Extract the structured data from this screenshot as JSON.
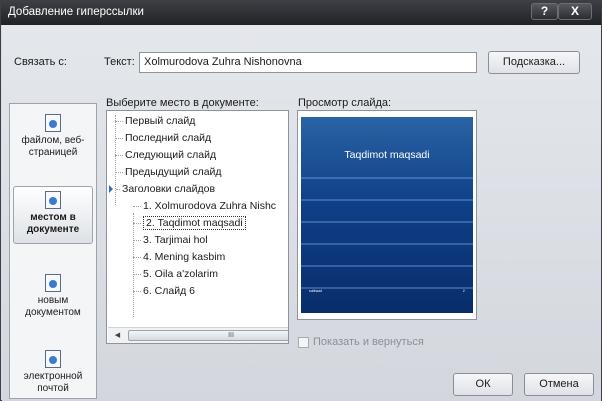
{
  "window": {
    "title": "Добавление гиперссылки",
    "help_label": "?",
    "close_label": "X"
  },
  "link_to": {
    "heading": "Связать с:",
    "items": [
      {
        "label_line1": "файлом, веб-",
        "label_line2": "страницей",
        "icon": "file-web-icon"
      },
      {
        "label_line1": "местом в",
        "label_line2": "документе",
        "icon": "place-in-document-icon",
        "selected": true
      },
      {
        "label_line1": "новым",
        "label_line2": "документом",
        "icon": "new-document-icon"
      },
      {
        "label_line1": "электронной",
        "label_line2": "почтой",
        "icon": "email-icon"
      }
    ]
  },
  "text_field": {
    "label": "Текст:",
    "value": "Xolmurodova Zuhra Nishonovna"
  },
  "tooltip_button": "Подсказка...",
  "place_in_doc": {
    "label": "Выберите место в документе:",
    "items": [
      {
        "text": "Первый слайд",
        "level": 1
      },
      {
        "text": "Последний слайд",
        "level": 1
      },
      {
        "text": "Следующий слайд",
        "level": 1
      },
      {
        "text": "Предыдущий слайд",
        "level": 1
      },
      {
        "text": "Заголовки слайдов",
        "level": 1,
        "expanded": true
      },
      {
        "text": "1. Xolmurodova Zuhra Nishc",
        "level": 2
      },
      {
        "text": "2. Taqdimot maqsadi",
        "level": 2,
        "selected": true
      },
      {
        "text": "3. Tarjimai hol",
        "level": 2
      },
      {
        "text": "4. Mening kasbim",
        "level": 2
      },
      {
        "text": "5. Oila a'zolarim",
        "level": 2
      },
      {
        "text": "6. Слайд 6",
        "level": 2
      }
    ],
    "hscroll_label": "III"
  },
  "preview": {
    "label": "Просмотр слайда:",
    "slide_title": "Taqdimot maqsadi",
    "footer_left": "ˢᵘᵇʰᵉᵃᵈ",
    "footer_right": "²"
  },
  "show_and_return": {
    "label": "Показать и вернуться",
    "checked": false
  },
  "buttons": {
    "ok": "ОК",
    "cancel": "Отмена"
  },
  "colors": {
    "titlebar": "#2b2d31",
    "slide_bg": "#0e3f87",
    "accent": "#2d6fc7"
  }
}
